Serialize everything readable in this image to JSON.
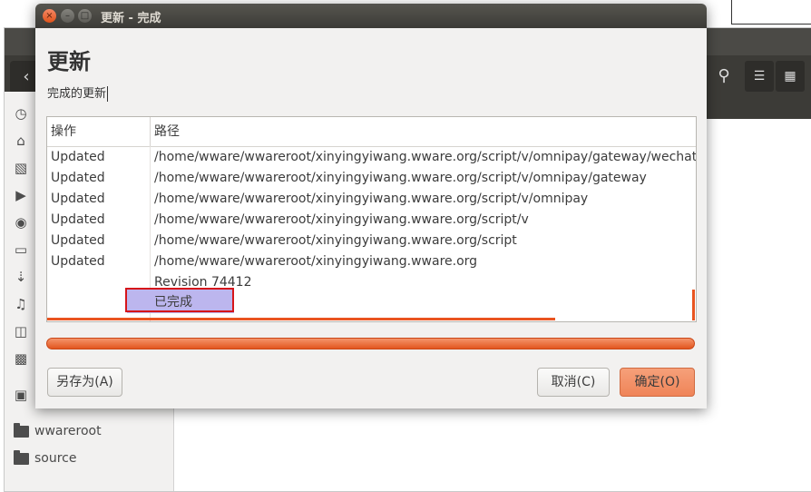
{
  "dialog": {
    "title": "更新 - 完成",
    "heading": "更新",
    "subheading": "完成的更新",
    "columns": {
      "operation": "操作",
      "path": "路径"
    },
    "rows": [
      {
        "op": "Updated",
        "path": "/home/wware/wwareroot/xinyingyiwang.wware.org/script/v/omnipay/gateway/wechat"
      },
      {
        "op": "Updated",
        "path": "/home/wware/wwareroot/xinyingyiwang.wware.org/script/v/omnipay/gateway"
      },
      {
        "op": "Updated",
        "path": "/home/wware/wwareroot/xinyingyiwang.wware.org/script/v/omnipay"
      },
      {
        "op": "Updated",
        "path": "/home/wware/wwareroot/xinyingyiwang.wware.org/script/v"
      },
      {
        "op": "Updated",
        "path": "/home/wware/wwareroot/xinyingyiwang.wware.org/script"
      },
      {
        "op": "Updated",
        "path": "/home/wware/wwareroot/xinyingyiwang.wware.org"
      },
      {
        "op": "",
        "path": "Revision 74412"
      }
    ],
    "selected_status": "已完成",
    "progress": 1.0,
    "buttons": {
      "save_as": "另存为(A)",
      "cancel": "取消(C)",
      "ok": "确定(O)"
    }
  },
  "background": {
    "sidebar_places": [
      {
        "label": "wwareroot",
        "icon": "folder-icon"
      },
      {
        "label": "source",
        "icon": "folder-icon"
      }
    ],
    "sidebar_icons": [
      "recent-icon",
      "home-icon",
      "folder-icon",
      "video-icon",
      "camera-icon",
      "document-icon",
      "download-icon",
      "music-icon",
      "trash-icon",
      "network-icon",
      "drive-icon"
    ]
  },
  "colors": {
    "accent": "#e95420",
    "selection": "#bcb6ee",
    "highlight_box": "#d6151a"
  }
}
